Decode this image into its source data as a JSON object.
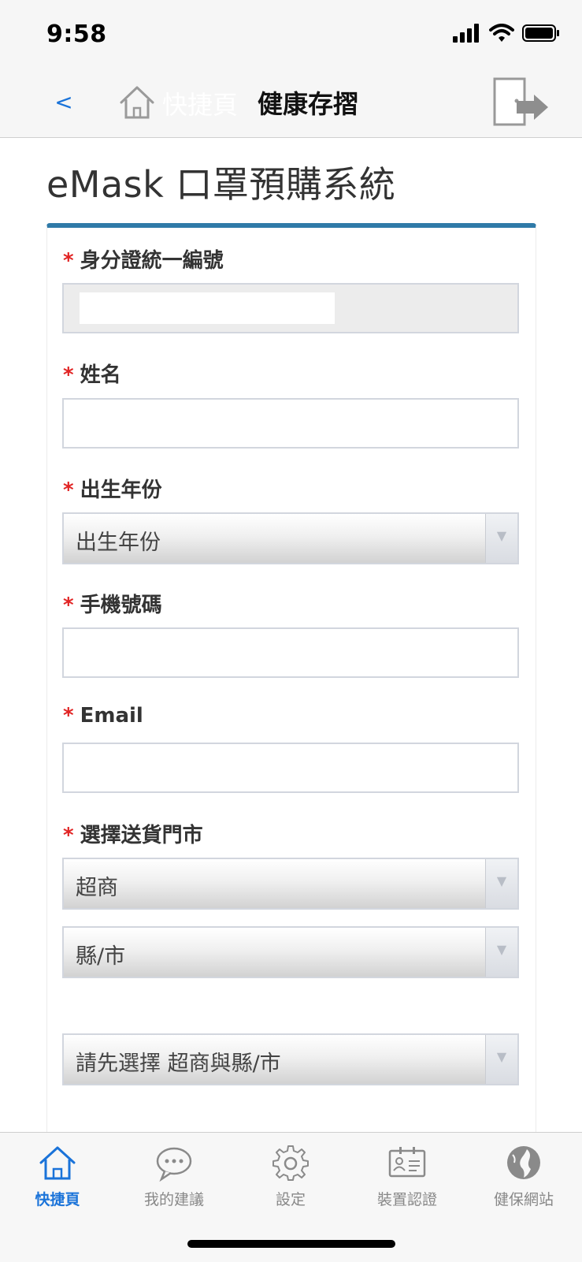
{
  "status_bar": {
    "time": "9:58"
  },
  "nav": {
    "back_label": "<",
    "home_label": "快捷頁",
    "title": "健康存摺"
  },
  "page": {
    "title": "eMask 口罩預購系統"
  },
  "form": {
    "id_label": "身分證統一編號",
    "name_label": "姓名",
    "birth_year_label": "出生年份",
    "birth_year_selected": "出生年份",
    "phone_label": "手機號碼",
    "email_label": "Email",
    "store_label": "選擇送貨門市",
    "store_type_selected": "超商",
    "county_selected": "縣/市",
    "store_selected": "請先選擇 超商與縣/市",
    "required_mark": "*"
  },
  "tabs": [
    {
      "label": "快捷頁",
      "icon": "home-icon",
      "active": true
    },
    {
      "label": "我的建議",
      "icon": "chat-icon",
      "active": false
    },
    {
      "label": "設定",
      "icon": "gear-icon",
      "active": false
    },
    {
      "label": "裝置認證",
      "icon": "id-card-icon",
      "active": false
    },
    {
      "label": "健保網站",
      "icon": "globe-icon",
      "active": false
    }
  ],
  "colors": {
    "accent": "#1a73d9",
    "required": "#e12323",
    "card_border": "#2f7aa8"
  }
}
